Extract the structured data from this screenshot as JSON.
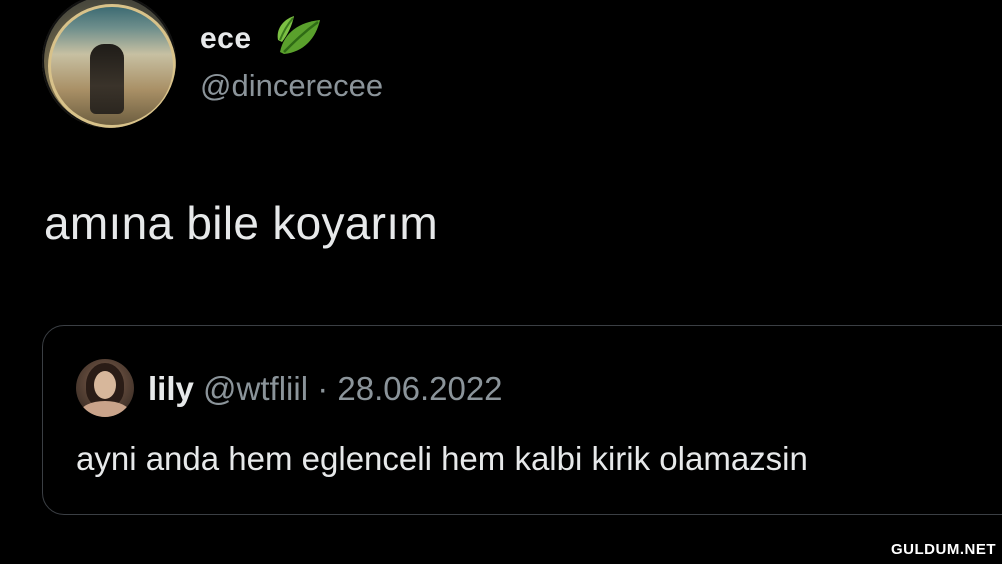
{
  "author": {
    "display_name": "ece",
    "name_emoji": "leaf-icon",
    "handle": "@dincerecee"
  },
  "tweet": {
    "text": "amına bile koyarım"
  },
  "quote": {
    "name": "lily",
    "handle": "@wtfliil",
    "separator": "·",
    "date": "28.06.2022",
    "text": "ayni anda hem eglenceli hem kalbi kirik olamazsin"
  },
  "watermark": "GULDUM.NET",
  "colors": {
    "background": "#000000",
    "primary_text": "#e7e9ea",
    "secondary_text": "#8b949a",
    "border": "#3b3f44"
  }
}
